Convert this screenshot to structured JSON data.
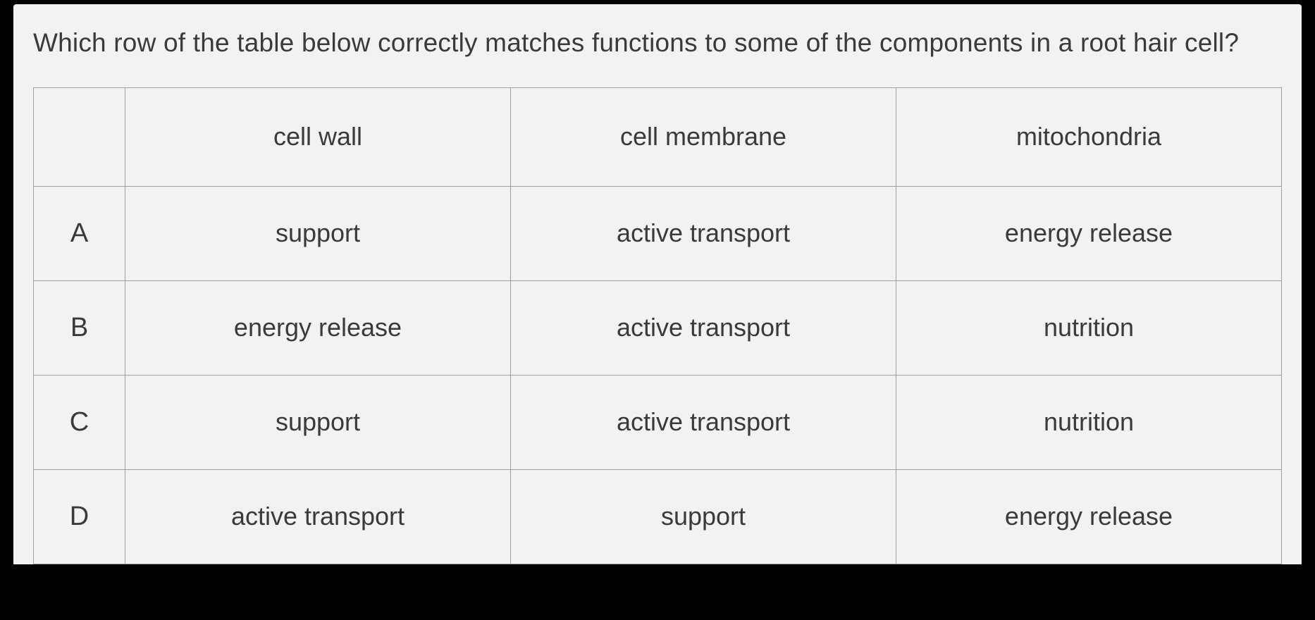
{
  "question": "Which row of the table below correctly matches functions to some of the components in a root hair cell?",
  "table": {
    "headers": [
      "",
      "cell wall",
      "cell membrane",
      "mitochondria"
    ],
    "rows": [
      {
        "label": "A",
        "cells": [
          "support",
          "active transport",
          "energy release"
        ]
      },
      {
        "label": "B",
        "cells": [
          "energy release",
          "active transport",
          "nutrition"
        ]
      },
      {
        "label": "C",
        "cells": [
          "support",
          "active transport",
          "nutrition"
        ]
      },
      {
        "label": "D",
        "cells": [
          "active transport",
          "support",
          "energy release"
        ]
      }
    ]
  }
}
